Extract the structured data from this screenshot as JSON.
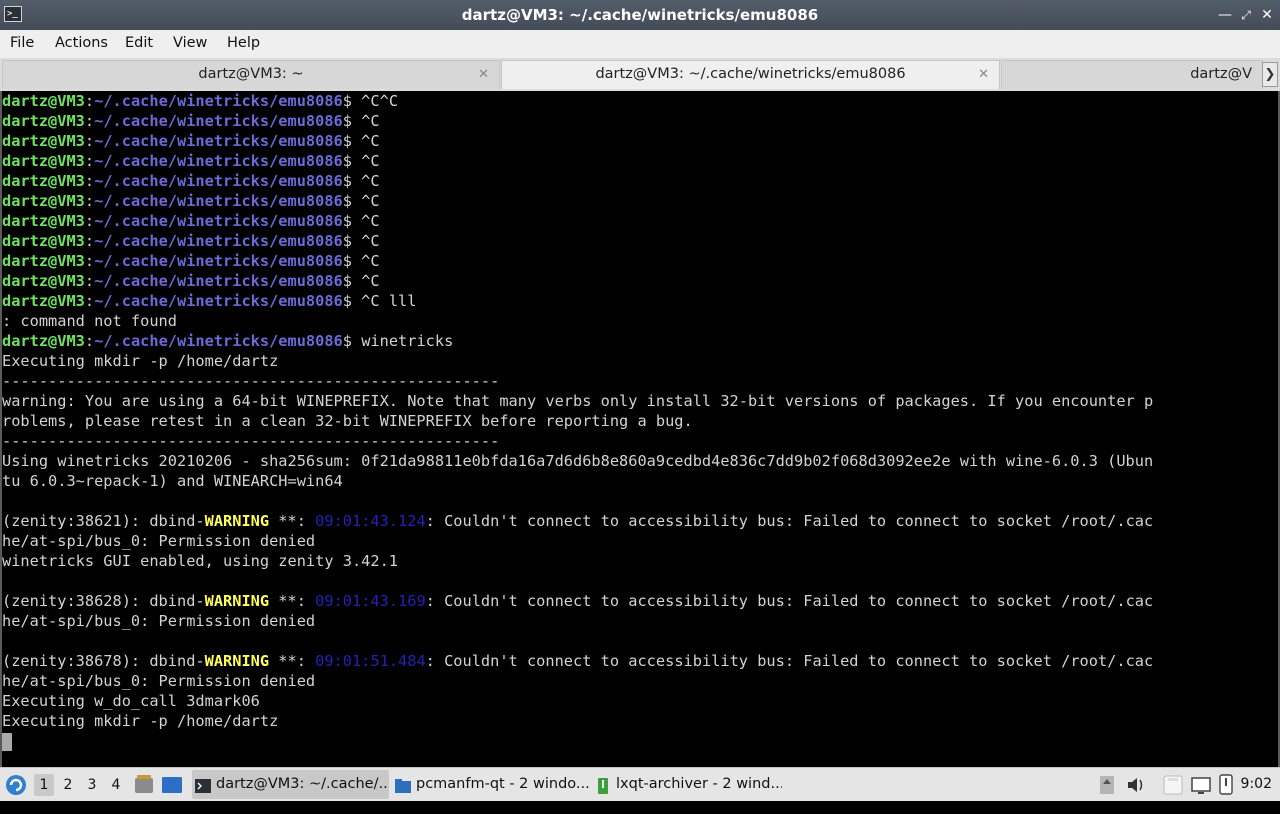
{
  "window": {
    "title": "dartz@VM3: ~/.cache/winetricks/emu8086"
  },
  "menubar": [
    "File",
    "Actions",
    "Edit",
    "View",
    "Help"
  ],
  "tabs": [
    {
      "label": "dartz@VM3: ~",
      "active": false
    },
    {
      "label": "dartz@VM3: ~/.cache/winetricks/emu8086",
      "active": true
    },
    {
      "label": "dartz@V",
      "active": false
    }
  ],
  "terminal": {
    "prompt_user": "dartz@VM3",
    "prompt_path": "~/.cache/winetricks/emu8086",
    "lines": [
      {
        "kind": "prompt",
        "cmd": " ^C^C"
      },
      {
        "kind": "prompt",
        "cmd": " ^C"
      },
      {
        "kind": "prompt",
        "cmd": " ^C"
      },
      {
        "kind": "prompt",
        "cmd": " ^C"
      },
      {
        "kind": "prompt",
        "cmd": " ^C"
      },
      {
        "kind": "prompt",
        "cmd": " ^C"
      },
      {
        "kind": "prompt",
        "cmd": " ^C"
      },
      {
        "kind": "prompt",
        "cmd": " ^C"
      },
      {
        "kind": "prompt",
        "cmd": " ^C"
      },
      {
        "kind": "prompt",
        "cmd": " ^C"
      },
      {
        "kind": "prompt",
        "cmd": " ^C lll"
      },
      {
        "kind": "text",
        "text": ": command not found"
      },
      {
        "kind": "prompt",
        "cmd": " winetricks"
      },
      {
        "kind": "text",
        "text": "Executing mkdir -p /home/dartz"
      },
      {
        "kind": "text",
        "text": "------------------------------------------------------"
      },
      {
        "kind": "text",
        "text": "warning: You are using a 64-bit WINEPREFIX. Note that many verbs only install 32-bit versions of packages. If you encounter p"
      },
      {
        "kind": "text",
        "text": "roblems, please retest in a clean 32-bit WINEPREFIX before reporting a bug."
      },
      {
        "kind": "text",
        "text": "------------------------------------------------------"
      },
      {
        "kind": "text",
        "text": "Using winetricks 20210206 - sha256sum: 0f21da98811e0bfda16a7d6d6b8e860a9cedbd4e836c7dd9b02f068d3092ee2e with wine-6.0.3 (Ubun"
      },
      {
        "kind": "text",
        "text": "tu 6.0.3~repack-1) and WINEARCH=win64"
      },
      {
        "kind": "text",
        "text": ""
      },
      {
        "kind": "warn",
        "pre": "(zenity:38621): dbind-",
        "label": "WARNING",
        "mid": " **: ",
        "time": "09:01:43.124",
        "post": ": Couldn't connect to accessibility bus: Failed to connect to socket /root/.cac"
      },
      {
        "kind": "text",
        "text": "he/at-spi/bus_0: Permission denied"
      },
      {
        "kind": "text",
        "text": "winetricks GUI enabled, using zenity 3.42.1"
      },
      {
        "kind": "text",
        "text": ""
      },
      {
        "kind": "warn",
        "pre": "(zenity:38628): dbind-",
        "label": "WARNING",
        "mid": " **: ",
        "time": "09:01:43.169",
        "post": ": Couldn't connect to accessibility bus: Failed to connect to socket /root/.cac"
      },
      {
        "kind": "text",
        "text": "he/at-spi/bus_0: Permission denied"
      },
      {
        "kind": "text",
        "text": ""
      },
      {
        "kind": "warn",
        "pre": "(zenity:38678): dbind-",
        "label": "WARNING",
        "mid": " **: ",
        "time": "09:01:51.484",
        "post": ": Couldn't connect to accessibility bus: Failed to connect to socket /root/.cac"
      },
      {
        "kind": "text",
        "text": "he/at-spi/bus_0: Permission denied"
      },
      {
        "kind": "text",
        "text": "Executing w_do_call 3dmark06"
      },
      {
        "kind": "text",
        "text": "Executing mkdir -p /home/dartz"
      },
      {
        "kind": "cursor"
      }
    ]
  },
  "taskbar": {
    "workspaces": [
      "1",
      "2",
      "3",
      "4"
    ],
    "tasks": [
      {
        "label": "dartz@VM3: ~/.cache/...",
        "icon": "terminal-icon",
        "active": true
      },
      {
        "label": "pcmanfm-qt - 2 windo...",
        "icon": "folder-icon",
        "active": false
      },
      {
        "label": "lxqt-archiver - 2 wind...",
        "icon": "archive-icon",
        "active": false
      }
    ],
    "clock": "9:02"
  },
  "colors": {
    "prompt_user": "#6ee35f",
    "prompt_path": "#6a6ad8",
    "warning": "#ffff55",
    "timestamp": "#2222b8"
  }
}
